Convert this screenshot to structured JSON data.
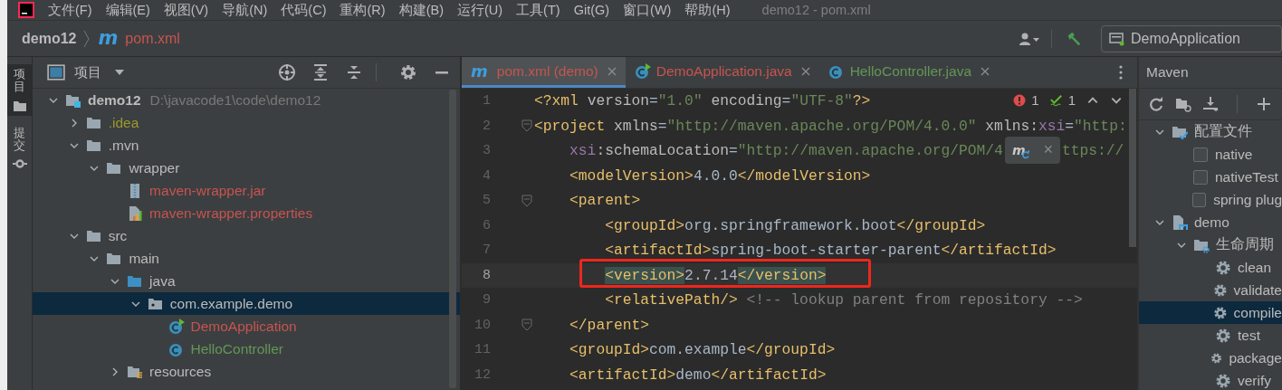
{
  "menu": [
    "文件(F)",
    "编辑(E)",
    "视图(V)",
    "导航(N)",
    "代码(C)",
    "重构(R)",
    "构建(B)",
    "运行(U)",
    "工具(T)",
    "Git(G)",
    "窗口(W)",
    "帮助(H)"
  ],
  "window_title": "demo12 - pom.xml",
  "breadcrumb": [
    {
      "label": "demo12",
      "color": "#bbbbbb"
    },
    {
      "glyph": "m",
      "label": "pom.xml",
      "color": "#c75450"
    }
  ],
  "run_config": {
    "label": "DemoApplication"
  },
  "side_stripe": [
    {
      "label": "项目",
      "kind": "folder",
      "selected": true
    },
    {
      "label": "提交",
      "kind": "commit",
      "selected": false
    }
  ],
  "project": {
    "title": "项目",
    "tree": [
      {
        "label": "demo12",
        "path": "D:\\javacode1\\code\\demo12",
        "kind": "module",
        "color": "#bbbbbb",
        "expanded": true,
        "selected": false,
        "children": [
          {
            "label": ".idea",
            "kind": "folder",
            "color": "#9a9a2c",
            "expanded": false,
            "selected": false
          },
          {
            "label": ".mvn",
            "kind": "folder",
            "color": "#bbbbbb",
            "expanded": true,
            "selected": false,
            "children": [
              {
                "label": "wrapper",
                "kind": "folder",
                "color": "#bbbbbb",
                "expanded": true,
                "selected": false,
                "children": [
                  {
                    "label": "maven-wrapper.jar",
                    "kind": "jar",
                    "color": "#c75450",
                    "selected": false
                  },
                  {
                    "label": "maven-wrapper.properties",
                    "kind": "properties",
                    "color": "#c75450",
                    "selected": false
                  }
                ]
              }
            ]
          },
          {
            "label": "src",
            "kind": "folder",
            "color": "#bbbbbb",
            "expanded": true,
            "selected": false,
            "children": [
              {
                "label": "main",
                "kind": "folder",
                "color": "#bbbbbb",
                "expanded": true,
                "selected": false,
                "children": [
                  {
                    "label": "java",
                    "kind": "source-folder",
                    "color": "#bbbbbb",
                    "expanded": true,
                    "selected": false,
                    "children": [
                      {
                        "label": "com.example.demo",
                        "kind": "package",
                        "color": "#bbbbbb",
                        "expanded": true,
                        "selected": true,
                        "children": [
                          {
                            "label": "DemoApplication",
                            "kind": "class-run",
                            "color": "#c75450",
                            "selected": false
                          },
                          {
                            "label": "HelloController",
                            "kind": "class",
                            "color": "#629755",
                            "selected": false
                          }
                        ]
                      }
                    ]
                  },
                  {
                    "label": "resources",
                    "kind": "resources-folder",
                    "color": "#bbbbbb",
                    "expanded": false,
                    "selected": false
                  }
                ]
              }
            ]
          }
        ]
      }
    ]
  },
  "editor": {
    "tabs": [
      {
        "kind": "maven",
        "glyph": "m",
        "label": "pom.xml (demo)",
        "color": "#c75450",
        "selected": true
      },
      {
        "kind": "class-run",
        "label": "DemoApplication.java",
        "color": "#c75450",
        "selected": false
      },
      {
        "kind": "class",
        "label": "HelloController.java",
        "color": "#629755",
        "selected": false
      }
    ],
    "inspections": {
      "errors": "1",
      "warnings": "1"
    },
    "lines": [
      {
        "number": "1",
        "current": false,
        "tokens": [
          {
            "kind": "tag",
            "text": "<?xml "
          },
          {
            "kind": "attr",
            "text": "version"
          },
          {
            "kind": "text",
            "text": "="
          },
          {
            "kind": "str",
            "text": "\"1.0\""
          },
          {
            "kind": "attr",
            "text": " encoding"
          },
          {
            "kind": "text",
            "text": "="
          },
          {
            "kind": "str",
            "text": "\"UTF-8\""
          },
          {
            "kind": "tag",
            "text": "?>"
          }
        ]
      },
      {
        "number": "2",
        "current": false,
        "fold": true,
        "tokens": [
          {
            "kind": "tag",
            "text": "<project"
          },
          {
            "kind": "attr",
            "text": " xmlns"
          },
          {
            "kind": "text",
            "text": "="
          },
          {
            "kind": "str",
            "text": "\"http://maven.apache.org/POM/4.0.0\""
          },
          {
            "kind": "attr",
            "text": " xmlns:"
          },
          {
            "kind": "ns",
            "text": "xsi"
          },
          {
            "kind": "text",
            "text": "="
          },
          {
            "kind": "str",
            "text": "\"http:"
          }
        ]
      },
      {
        "number": "3",
        "current": false,
        "tokens": [
          {
            "kind": "ns",
            "text": "    xsi"
          },
          {
            "kind": "attr",
            "text": ":schemaLocation"
          },
          {
            "kind": "text",
            "text": "="
          },
          {
            "kind": "str",
            "text": "\"http://maven.apache.org/POM/4"
          },
          {
            "kind": "popup",
            "glyph": "m",
            "text": "×"
          },
          {
            "kind": "str",
            "text": "ttps://"
          }
        ]
      },
      {
        "number": "4",
        "current": false,
        "tokens": [
          {
            "kind": "tag",
            "text": "    <modelVersion>"
          },
          {
            "kind": "text",
            "text": "4.0.0"
          },
          {
            "kind": "tag",
            "text": "</modelVersion>"
          }
        ]
      },
      {
        "number": "5",
        "current": false,
        "fold": true,
        "tokens": [
          {
            "kind": "tag",
            "text": "    <parent>"
          }
        ]
      },
      {
        "number": "6",
        "current": false,
        "tokens": [
          {
            "kind": "tag",
            "text": "        <groupId>"
          },
          {
            "kind": "text",
            "text": "org.springframework.boot"
          },
          {
            "kind": "tag",
            "text": "</groupId>"
          }
        ]
      },
      {
        "number": "7",
        "current": false,
        "tokens": [
          {
            "kind": "tag",
            "text": "        <artifactId>"
          },
          {
            "kind": "text",
            "text": "spring-boot-starter-parent"
          },
          {
            "kind": "tag",
            "text": "</artifactId>"
          }
        ]
      },
      {
        "number": "8",
        "current": true,
        "tokens": [
          {
            "kind": "match",
            "text": "        <version>"
          },
          {
            "kind": "text",
            "text": "2.7.14"
          },
          {
            "kind": "match",
            "text": "</version>"
          }
        ]
      },
      {
        "number": "9",
        "current": false,
        "tokens": [
          {
            "kind": "tag",
            "text": "        <relativePath/>"
          },
          {
            "kind": "comment",
            "text": " <!-- lookup parent from repository -->"
          }
        ]
      },
      {
        "number": "10",
        "current": false,
        "fold": true,
        "tokens": [
          {
            "kind": "tag",
            "text": "    </parent>"
          }
        ]
      },
      {
        "number": "11",
        "current": false,
        "tokens": [
          {
            "kind": "tag",
            "text": "    <groupId>"
          },
          {
            "kind": "text",
            "text": "com.example"
          },
          {
            "kind": "tag",
            "text": "</groupId>"
          }
        ]
      },
      {
        "number": "12",
        "current": false,
        "tokens": [
          {
            "kind": "tag",
            "text": "    <artifactId>"
          },
          {
            "kind": "text",
            "text": "demo"
          },
          {
            "kind": "tag",
            "text": "</artifactId>"
          }
        ]
      }
    ]
  },
  "maven": {
    "title": "Maven",
    "tree": [
      {
        "label": "配置文件",
        "kind": "profiles",
        "expanded": true,
        "selected": false,
        "children": [
          {
            "label": "native",
            "kind": "profile",
            "checked": false,
            "selected": false
          },
          {
            "label": "nativeTest",
            "kind": "profile",
            "checked": false,
            "selected": false
          },
          {
            "label": "spring plug",
            "kind": "profile",
            "checked": false,
            "selected": false
          }
        ]
      },
      {
        "label": "demo",
        "kind": "project",
        "expanded": true,
        "selected": false,
        "children": [
          {
            "label": "生命周期",
            "kind": "lifecycle",
            "expanded": true,
            "selected": false,
            "children": [
              {
                "label": "clean",
                "kind": "goal",
                "selected": false
              },
              {
                "label": "validate",
                "kind": "goal",
                "selected": false
              },
              {
                "label": "compile",
                "kind": "goal",
                "selected": true
              },
              {
                "label": "test",
                "kind": "goal",
                "selected": false
              },
              {
                "label": "package",
                "kind": "goal",
                "selected": false
              },
              {
                "label": "verify",
                "kind": "goal",
                "selected": false
              }
            ]
          }
        ]
      }
    ]
  }
}
